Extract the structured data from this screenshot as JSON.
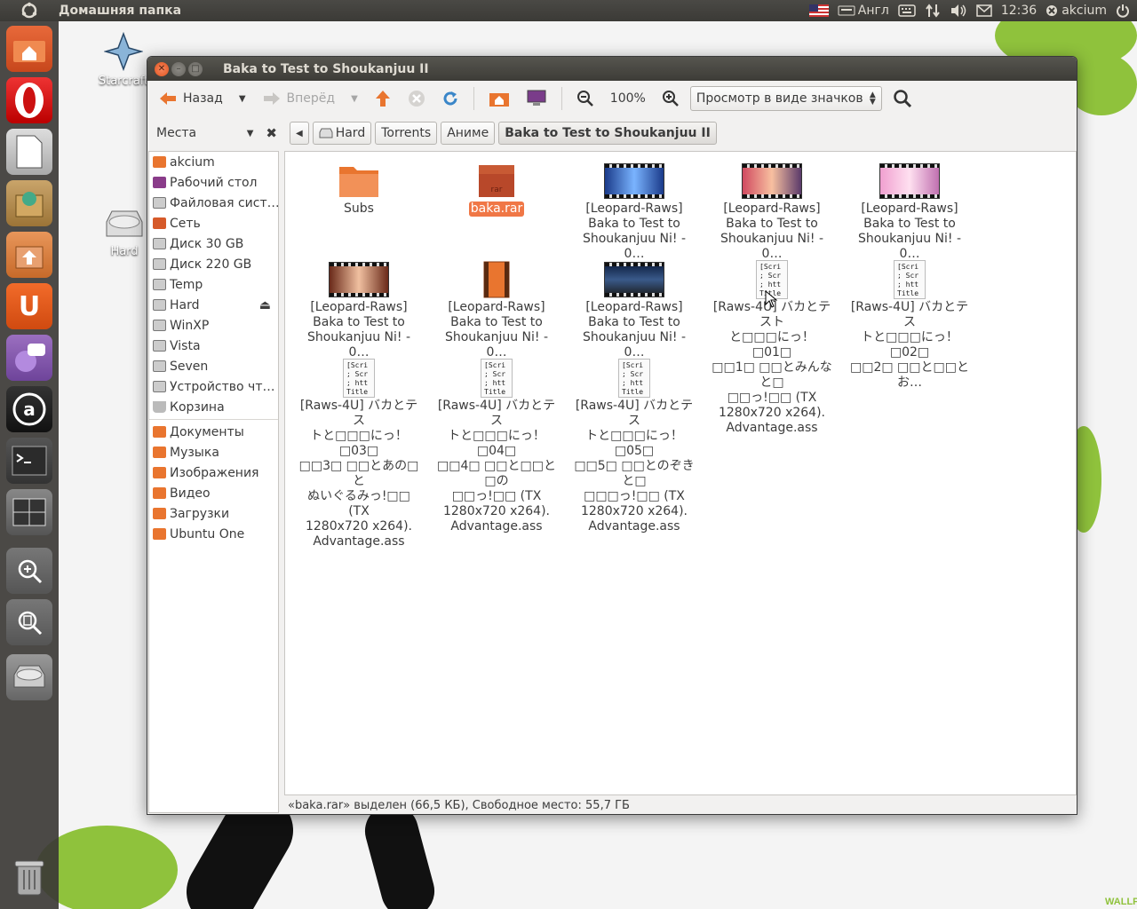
{
  "panel": {
    "app_title": "Домашняя папка",
    "keyboard_layout": "Англ",
    "time": "12:36",
    "user": "akcium"
  },
  "desktop": {
    "icons": [
      {
        "label": "Starcraft"
      },
      {
        "label": "Hard"
      }
    ],
    "watermark": "WALLP"
  },
  "window": {
    "title": "Baka to Test to Shoukanjuu II",
    "toolbar": {
      "back": "Назад",
      "forward": "Вперёд",
      "zoom": "100%",
      "view_mode": "Просмотр в виде значков"
    },
    "places_label": "Места",
    "breadcrumbs": [
      "Hard",
      "Torrents",
      "Аниме",
      "Baka to Test to Shoukanjuu II"
    ],
    "sidebar": {
      "devices": [
        "akcium",
        "Рабочий стол",
        "Файловая сист…",
        "Сеть",
        "Диск 30 GB",
        "Диск 220 GB",
        "Temp",
        "Hard",
        "WinXP",
        "Vista",
        "Seven",
        "Устройство чт…",
        "Корзина"
      ],
      "bookmarks": [
        "Документы",
        "Музыка",
        "Изображения",
        "Видео",
        "Загрузки",
        "Ubuntu One"
      ]
    },
    "files": [
      {
        "line1": "Subs",
        "line2": "",
        "line3": "",
        "line4": "",
        "line5": "",
        "line6": ""
      },
      {
        "line1": "baka.rar",
        "line2": "",
        "line3": "",
        "line4": "",
        "line5": "",
        "line6": ""
      },
      {
        "line1": "[Leopard-Raws]",
        "line2": "Baka to Test to",
        "line3": "Shoukanjuu Ni! - 0…",
        "line4": "",
        "line5": "",
        "line6": ""
      },
      {
        "line1": "[Leopard-Raws]",
        "line2": "Baka to Test to",
        "line3": "Shoukanjuu Ni! - 0…",
        "line4": "",
        "line5": "",
        "line6": ""
      },
      {
        "line1": "[Leopard-Raws]",
        "line2": "Baka to Test to",
        "line3": "Shoukanjuu Ni! - 0…",
        "line4": "",
        "line5": "",
        "line6": ""
      },
      {
        "line1": "[Leopard-Raws]",
        "line2": "Baka to Test to",
        "line3": "Shoukanjuu Ni! - 0…",
        "line4": "",
        "line5": "",
        "line6": ""
      },
      {
        "line1": "[Leopard-Raws]",
        "line2": "Baka to Test to",
        "line3": "Shoukanjuu Ni! - 0…",
        "line4": "",
        "line5": "",
        "line6": ""
      },
      {
        "line1": "[Leopard-Raws]",
        "line2": "Baka to Test to",
        "line3": "Shoukanjuu Ni! - 0…",
        "line4": "",
        "line5": "",
        "line6": ""
      },
      {
        "line1": "[Raws-4U] バカとテスト",
        "line2": "と□□□にっ！ □01□",
        "line3": "□□1□ □□とみんなと□",
        "line4": "□□っ!□□ (TX",
        "line5": "1280x720 x264).",
        "line6": "Advantage.ass"
      },
      {
        "line1": "[Raws-4U] バカとテス",
        "line2": "トと□□□にっ！ □02□",
        "line3": "□□2□ □□と□□とお…",
        "line4": "",
        "line5": "",
        "line6": ""
      },
      {
        "line1": "[Raws-4U] バカとテス",
        "line2": "トと□□□にっ！ □03□",
        "line3": "□□3□ □□とあの□と",
        "line4": "ぬいぐるみっ!□□ (TX",
        "line5": "1280x720 x264).",
        "line6": "Advantage.ass"
      },
      {
        "line1": "[Raws-4U] バカとテス",
        "line2": "トと□□□にっ！ □04□",
        "line3": "□□4□ □□と□□と□の",
        "line4": "□□っ!□□ (TX",
        "line5": "1280x720 x264).",
        "line6": "Advantage.ass"
      },
      {
        "line1": "[Raws-4U] バカとテス",
        "line2": "トと□□□にっ！ □05□",
        "line3": "□□5□ □□とのぞきと□",
        "line4": "□□□っ!□□ (TX",
        "line5": "1280x720 x264).",
        "line6": "Advantage.ass"
      }
    ],
    "txt_preview": [
      "[Scri",
      "; Scr",
      "; htt",
      "Title"
    ],
    "status": "«baka.rar» выделен (66,5 КБ), Свободное место: 55,7 ГБ"
  }
}
